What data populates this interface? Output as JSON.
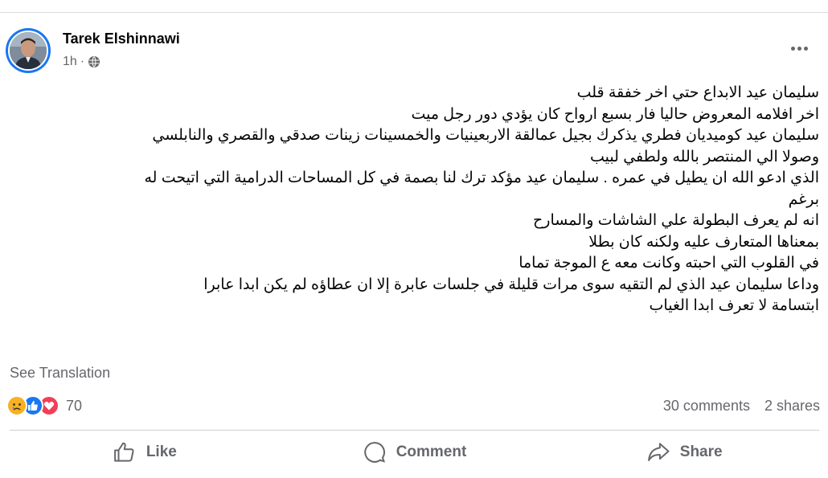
{
  "post": {
    "author": "Tarek Elshinnawi",
    "time": "1h",
    "separator": "·",
    "privacy_icon": "globe-icon",
    "more_icon": "more-options-icon",
    "lines": [
      "سليمان عيد الابداع حتي اخر  خفقة قلب",
      "اخر افلامه المعروض حاليا فار بسبع ارواح كان يؤدي دور رجل ميت",
      "سليمان عيد كوميديان فطري  يذكرك بجيل عمالقة الاربعينيات والخمسينات زينات صدقي والقصري والنابلسي",
      "وصولا الي المنتصر بالله ولطفي لبيب",
      "الذي ادعو الله ان يطيل في عمره  . سليمان عيد مؤكد ترك لنا بصمة في كل المساحات الدرامية التي اتيحت له",
      "برغم",
      "انه لم يعرف البطولة علي الشاشات والمسارح",
      "بمعناها المتعارف عليه ولكنه كان بطلا",
      "في القلوب التي احبته وكانت معه ع الموجة تماما",
      "وداعا سليمان عيد الذي لم التقيه سوى مرات قليلة في جلسات عابرة إلا ان  عطاؤه لم يكن ابدا عابرا",
      "ابتسامة لا تعرف ابدا الغياب"
    ],
    "see_translation": "See Translation"
  },
  "engagement": {
    "reactions": [
      "sad-reaction-icon",
      "like-reaction-icon",
      "love-reaction-icon"
    ],
    "reaction_count": "70",
    "comments": "30 comments",
    "shares": "2 shares"
  },
  "actions": {
    "like": "Like",
    "comment": "Comment",
    "share": "Share"
  },
  "colors": {
    "brand_blue": "#1877f2",
    "secondary_text": "#65676b",
    "love_red": "#f33e58",
    "sad_yellow": "#f7b125"
  }
}
